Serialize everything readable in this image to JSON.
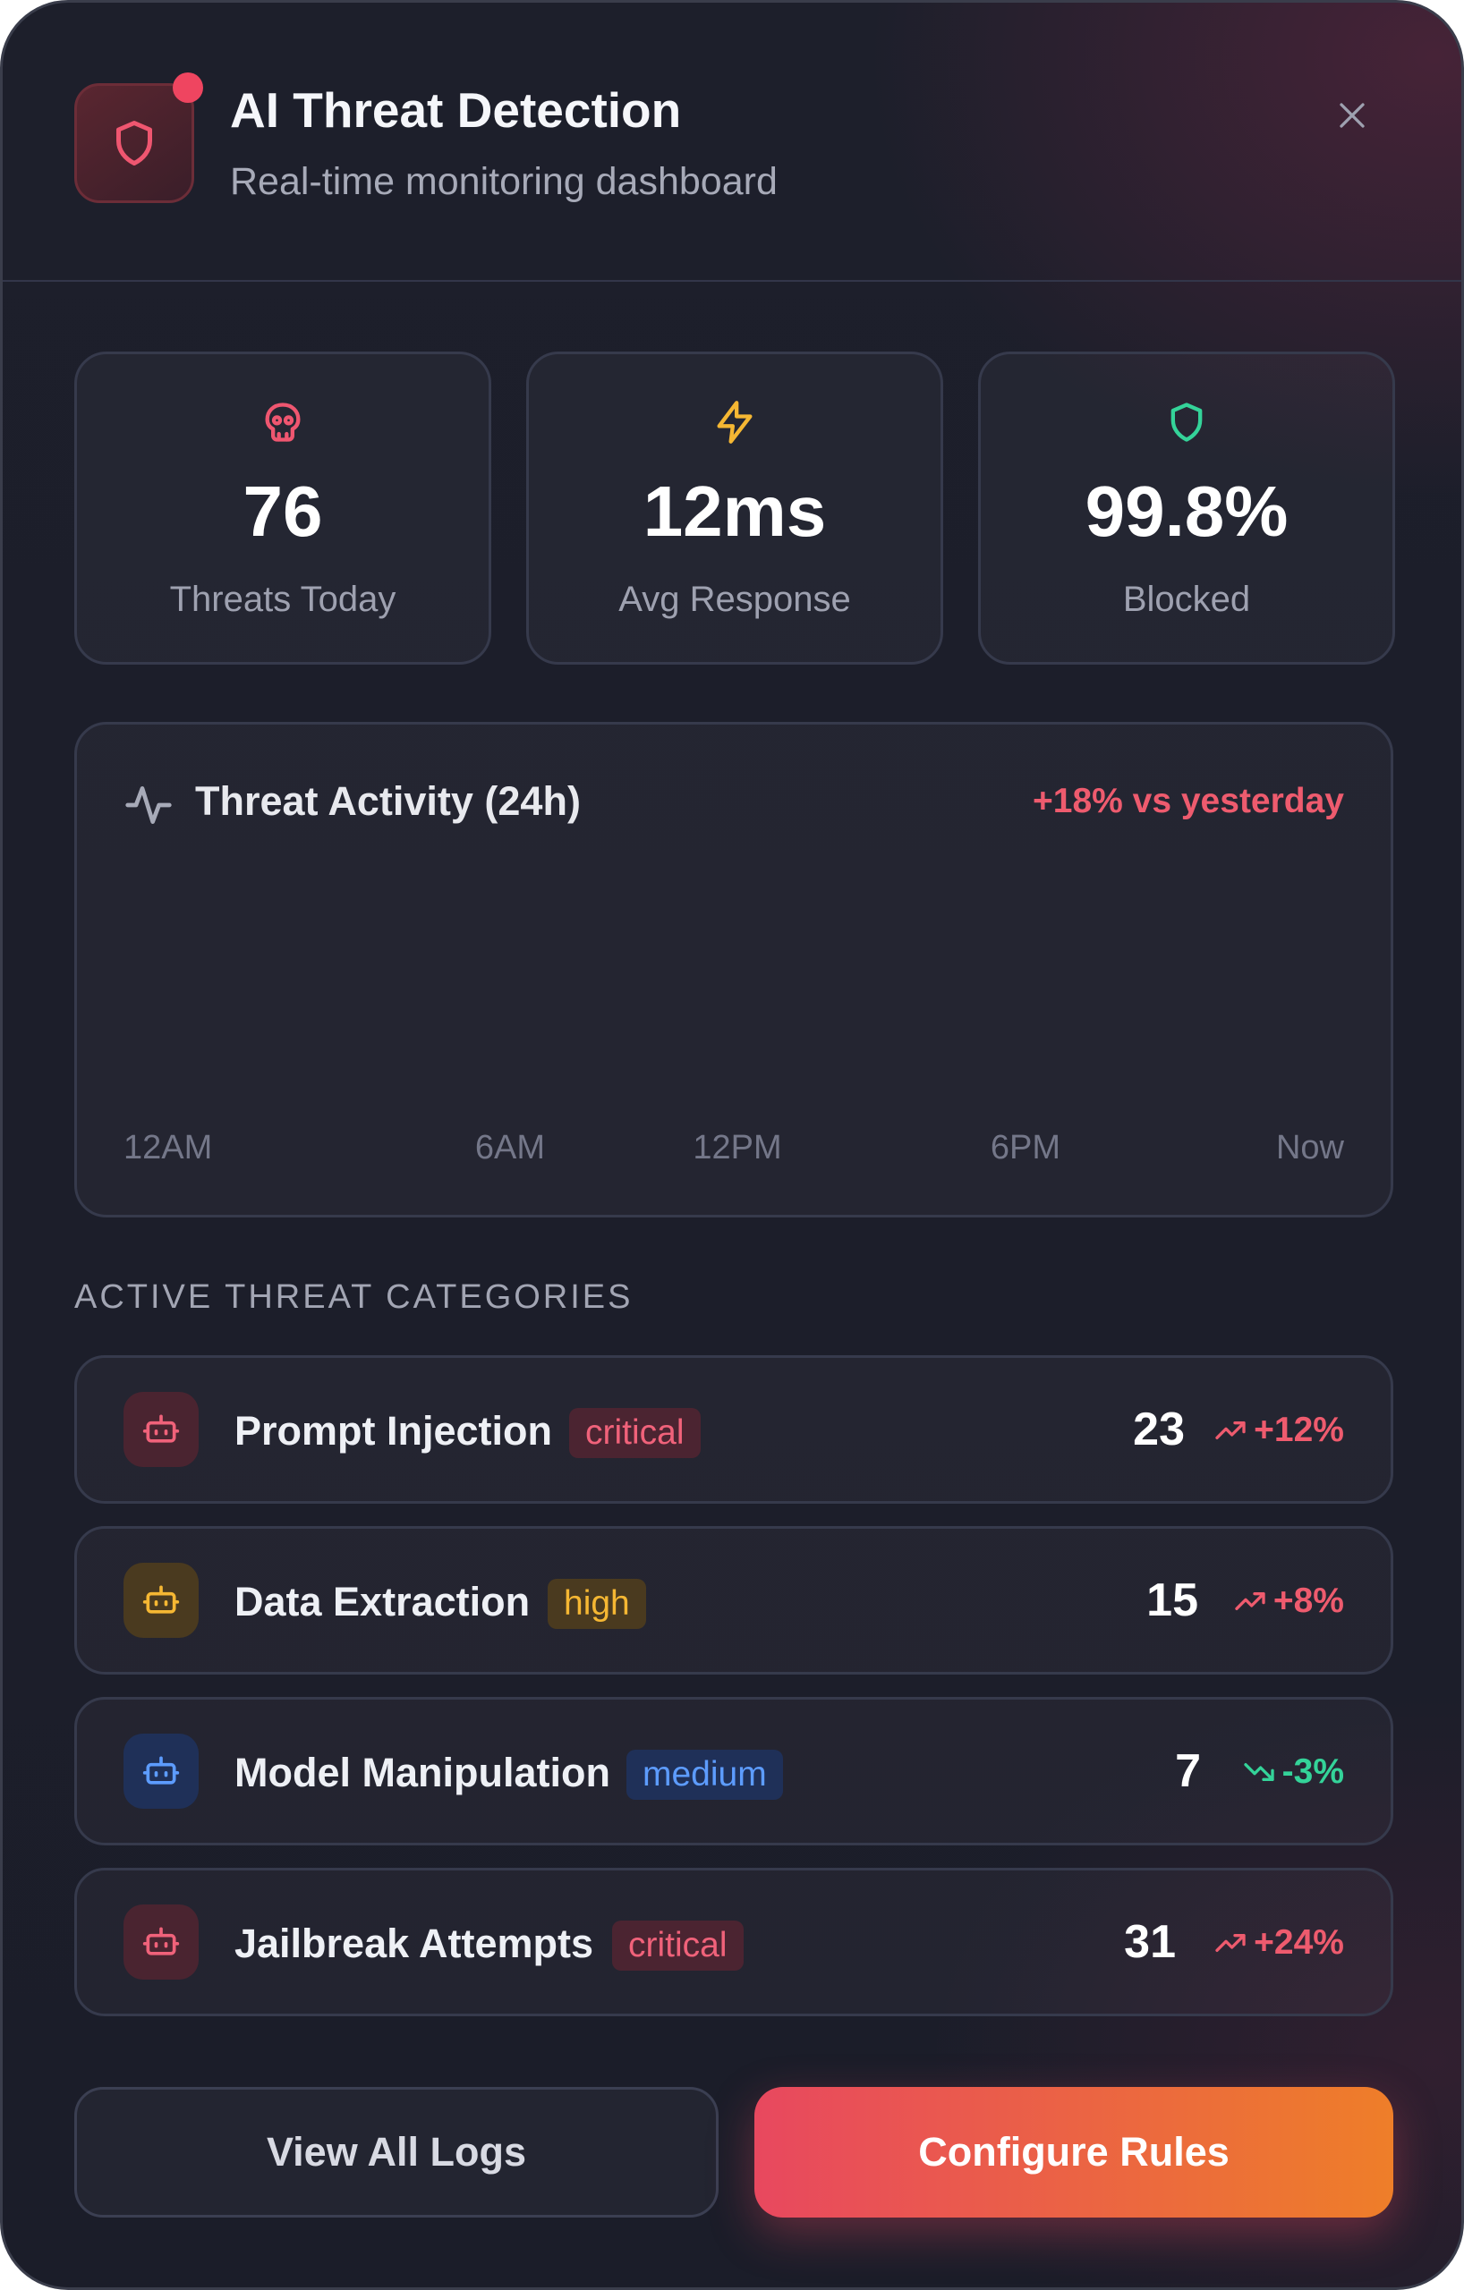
{
  "header": {
    "title": "AI Threat Detection",
    "subtitle": "Real-time monitoring dashboard",
    "alert_dot_color": "#ef4560"
  },
  "stats": [
    {
      "icon": "skull-icon",
      "value": "76",
      "label": "Threats Today",
      "color": "#ef5670"
    },
    {
      "icon": "lightning-icon",
      "value": "12ms",
      "label": "Avg Response",
      "color": "#f5b733"
    },
    {
      "icon": "shield-icon",
      "value": "99.8%",
      "label": "Blocked",
      "color": "#34d399"
    }
  ],
  "activity": {
    "title": "Threat Activity (24h)",
    "delta": "+18% vs yesterday",
    "ticks": [
      "12AM",
      "6AM",
      "12PM",
      "6PM",
      "Now"
    ]
  },
  "categories": {
    "section_title": "ACTIVE THREAT CATEGORIES",
    "items": [
      {
        "name": "Prompt Injection",
        "severity": "critical",
        "count": "23",
        "trend": "+12%",
        "direction": "up",
        "color": "#f0627a"
      },
      {
        "name": "Data Extraction",
        "severity": "high",
        "count": "15",
        "trend": "+8%",
        "direction": "up",
        "color": "#f5b733"
      },
      {
        "name": "Model Manipulation",
        "severity": "medium",
        "count": "7",
        "trend": "-3%",
        "direction": "down",
        "color": "#5d9cff"
      },
      {
        "name": "Jailbreak Attempts",
        "severity": "critical",
        "count": "31",
        "trend": "+24%",
        "direction": "up",
        "color": "#f0627a"
      }
    ]
  },
  "actions": {
    "secondary_label": "View All Logs",
    "primary_label": "Configure Rules"
  },
  "colors": {
    "accent_start": "#e8485f",
    "accent_end": "#ee7e29",
    "trend_up": "#ee5b6e",
    "trend_down": "#34d399"
  }
}
